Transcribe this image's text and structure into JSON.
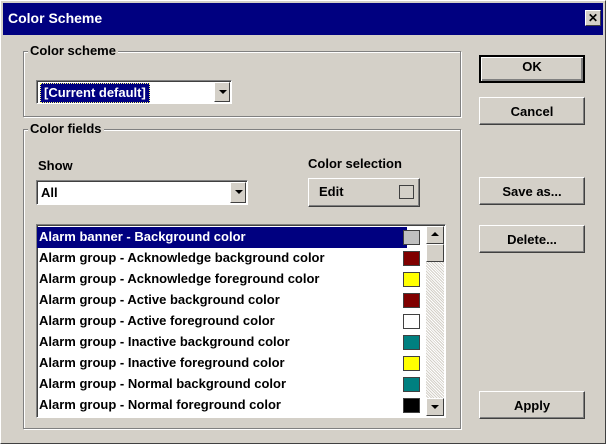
{
  "window": {
    "title": "Color Scheme",
    "close_glyph": "✕"
  },
  "color_scheme_group": {
    "legend": "Color scheme",
    "selected_value": "[Current default]"
  },
  "color_fields_group": {
    "legend": "Color fields",
    "show_label": "Show",
    "show_value": "All",
    "color_selection_label": "Color selection",
    "edit_label": "Edit"
  },
  "color_list": [
    {
      "label": "Alarm banner - Background color",
      "color": "#c0c0c0",
      "selected": true
    },
    {
      "label": "Alarm group - Acknowledge background color",
      "color": "#800000"
    },
    {
      "label": "Alarm group - Acknowledge foreground color",
      "color": "#ffff00"
    },
    {
      "label": "Alarm group - Active background color",
      "color": "#800000"
    },
    {
      "label": "Alarm group - Active foreground color",
      "color": "#ffffff"
    },
    {
      "label": "Alarm group - Inactive background color",
      "color": "#008080"
    },
    {
      "label": "Alarm group - Inactive foreground color",
      "color": "#ffff00"
    },
    {
      "label": "Alarm group - Normal background color",
      "color": "#008080"
    },
    {
      "label": "Alarm group - Normal foreground color",
      "color": "#000000"
    }
  ],
  "buttons": {
    "ok": "OK",
    "cancel": "Cancel",
    "save_as": "Save as...",
    "delete": "Delete...",
    "apply": "Apply"
  }
}
